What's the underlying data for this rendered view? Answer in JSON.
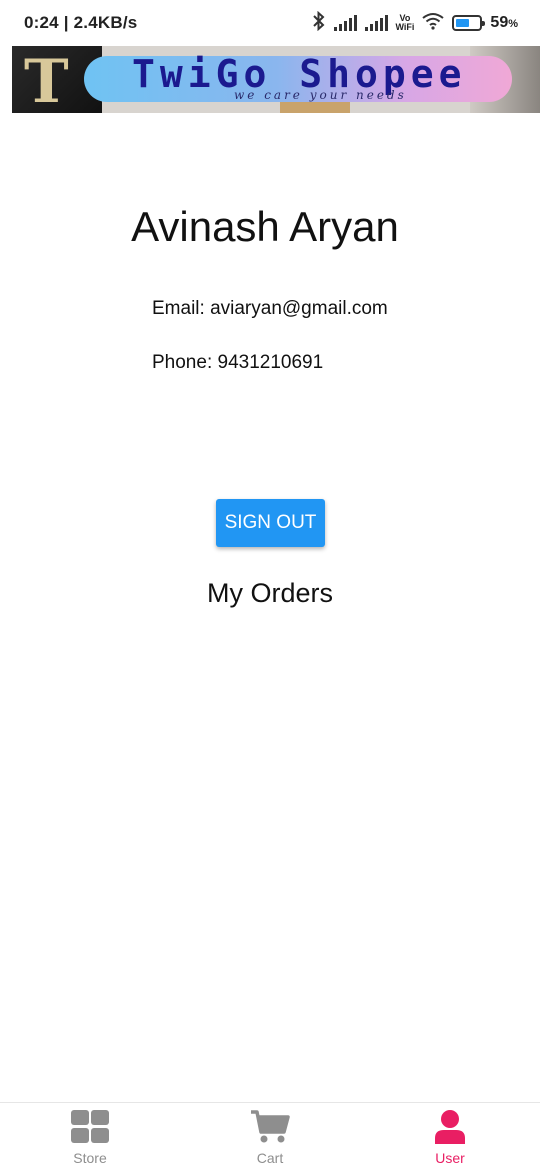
{
  "status_bar": {
    "time_speed": "0:24 | 2.4KB/s",
    "vowifi_top": "Vo",
    "vowifi_bottom": "WiFi",
    "battery_level_percent": 59,
    "battery_text": "59",
    "battery_unit": "%"
  },
  "banner": {
    "brand": "TwiGo Shopee",
    "tagline": "we care your needs"
  },
  "profile": {
    "name": "Avinash Aryan",
    "email_label": "Email: aviaryan@gmail.com",
    "phone_label": "Phone: 9431210691",
    "signout_label": "SIGN OUT",
    "orders_title": "My Orders"
  },
  "tabs": [
    {
      "label": "Store",
      "icon": "grid-icon",
      "active": false
    },
    {
      "label": "Cart",
      "icon": "cart-icon",
      "active": false
    },
    {
      "label": "User",
      "icon": "user-icon",
      "active": true
    }
  ],
  "colors": {
    "accent": "#2196f3",
    "active_tab": "#e91e63",
    "inactive_tab": "#8e8e8e"
  }
}
